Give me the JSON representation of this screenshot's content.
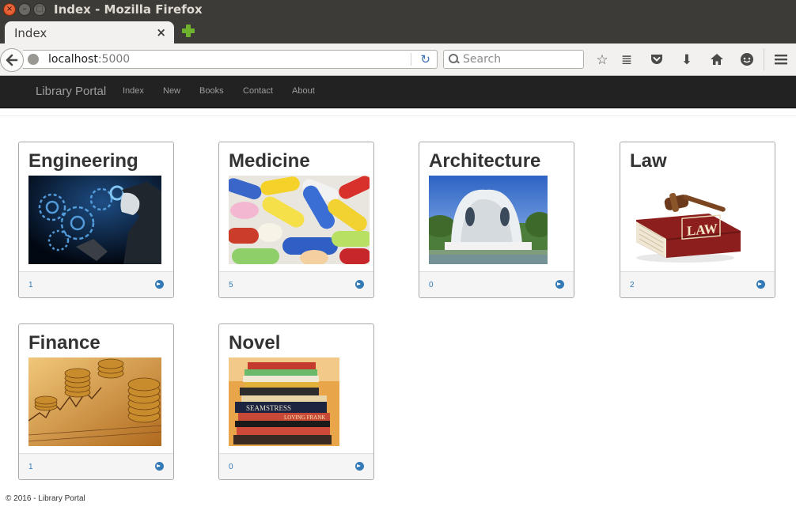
{
  "window": {
    "title": "Index - Mozilla Firefox",
    "close_glyph": "×",
    "min_glyph": "–",
    "max_glyph": "□"
  },
  "browser": {
    "tab_label": "Index",
    "tab_close": "×",
    "url_host": "localhost",
    "url_port": ":5000",
    "reload_glyph": "↻",
    "search_placeholder": "Search",
    "icons": {
      "bookmark": "☆",
      "reader": "≣",
      "pocket": "◡",
      "download": "⬇",
      "home": "⌂",
      "hello": "☻",
      "menu": "≡"
    }
  },
  "app": {
    "brand": "Library Portal",
    "nav": [
      "Index",
      "New",
      "Books",
      "Contact",
      "About"
    ],
    "accent_color": "#337ab7",
    "navbar_color": "#222222"
  },
  "categories": [
    {
      "title": "Engineering",
      "count": "1",
      "image": "gears-hand-image"
    },
    {
      "title": "Medicine",
      "count": "5",
      "image": "capsules-image"
    },
    {
      "title": "Architecture",
      "count": "0",
      "image": "building-image"
    },
    {
      "title": "Law",
      "count": "2",
      "image": "law-book-gavel-image",
      "image_text": "LAW"
    },
    {
      "title": "Finance",
      "count": "1",
      "image": "coins-chart-image"
    },
    {
      "title": "Novel",
      "count": "0",
      "image": "book-stack-image",
      "image_text": [
        "SEAMSTRESS",
        "LOVING FRANK"
      ]
    }
  ],
  "footer": "© 2016 - Library Portal"
}
